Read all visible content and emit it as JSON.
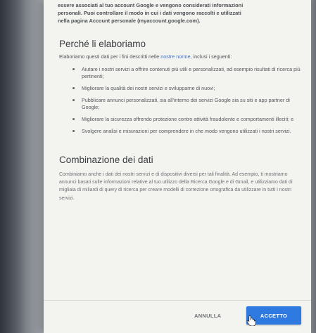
{
  "intro": {
    "line1": "essere associati al tuo account Google e vengono considerati informazioni",
    "line2": "personali. Puoi controllare il modo in cui i dati vengono raccolti e utilizzati",
    "line3": "nella pagina Account personale (myaccount.google.com)."
  },
  "purpose": {
    "heading": "Perché li elaboriamo",
    "lead_before": "Elaboriamo questi dati per i fini descritti nelle",
    "lead_link": "nostre norme",
    "lead_after": ", inclusi i seguenti:",
    "bullets": [
      "Aiutare i nostri servizi a offrire contenuti più utili e personalizzati, ad esempio risultati di ricerca più pertinenti;",
      "Migliorare la qualità dei nostri servizi e svilupparne di nuovi;",
      "Pubblicare annunci personalizzati, sia all'interno dei servizi Google sia su siti e app partner di Google;",
      "Migliorare la sicurezza offrendo protezione contro attività fraudolente e comportamenti illeciti; e",
      "Svolgere analisi e misurazioni per comprendere in che modo vengono utilizzati i nostri servizi."
    ]
  },
  "combination": {
    "heading": "Combinazione dei dati",
    "text": "Combiniamo anche i dati dei nostri servizi e di dispositivi diversi per tali finalità. Ad esempio, ti mostriamo annunci basati sulle informazioni relative al tuo utilizzo della Ricerca Google e di Gmail, e utilizziamo dati di migliaia di miliardi di query di ricerca per creare modelli di correzione ortografica da utilizzare in tutti i nostri servizi."
  },
  "footer": {
    "cancel_label": "ANNULLA",
    "accept_label": "ACCETTO"
  },
  "colors": {
    "accent": "#2f7ae0",
    "link": "#3b6fd0",
    "dialog_bg": "#f3f3ef"
  }
}
